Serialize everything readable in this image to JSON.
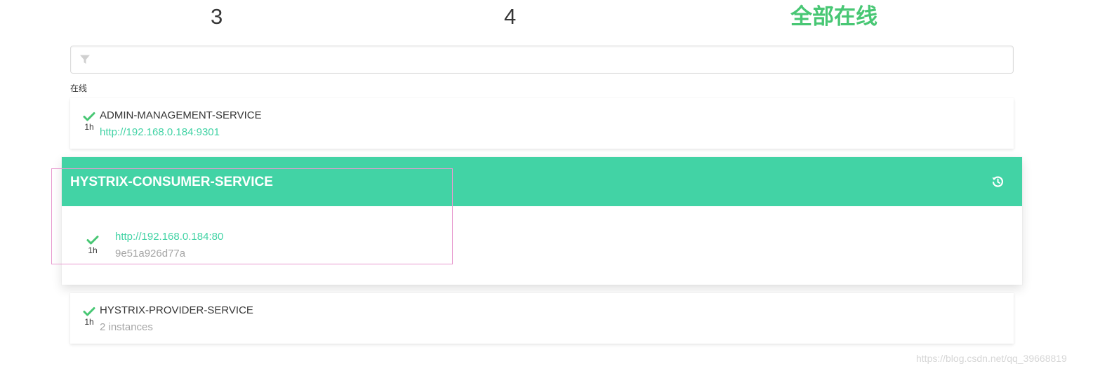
{
  "stats": {
    "applications": "3",
    "instances": "4",
    "status": "全部在线"
  },
  "filter": {
    "placeholder": "",
    "value": ""
  },
  "status_group": {
    "heading": "在线"
  },
  "applications": [
    {
      "name": "ADMIN-MANAGEMENT-SERVICE",
      "since": "1h",
      "detail": "http://192.168.0.184:9301",
      "status_icon": "check-icon"
    },
    {
      "name": "HYSTRIX-CONSUMER-SERVICE",
      "header_icon": "history-icon",
      "instance": {
        "url": "http://192.168.0.184:80",
        "id": "9e51a926d77a",
        "since": "1h",
        "status_icon": "check-icon"
      }
    },
    {
      "name": "HYSTRIX-PROVIDER-SERVICE",
      "since": "1h",
      "detail": "2 instances",
      "status_icon": "check-icon"
    }
  ],
  "colors": {
    "accent": "#42d3a5",
    "success": "#48c774",
    "text": "#363636",
    "muted": "#a5a5a5",
    "highlight_outline": "#e89bd0"
  },
  "watermark": "https://blog.csdn.net/qq_39668819"
}
